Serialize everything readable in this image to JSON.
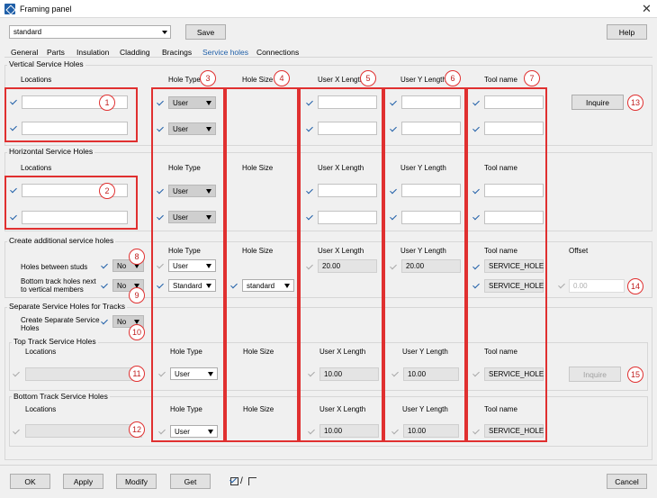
{
  "window": {
    "title": "Framing panel"
  },
  "top": {
    "preset": "standard",
    "save_label": "Save",
    "help_label": "Help"
  },
  "tabs": [
    "General",
    "Parts",
    "Insulation",
    "Cladding",
    "Bracings",
    "Service holes",
    "Connections"
  ],
  "headers": {
    "locations": "Locations",
    "hole_type": "Hole Type",
    "hole_size": "Hole Size",
    "user_x": "User X Length",
    "user_y": "User Y Length",
    "tool_name": "Tool name",
    "offset": "Offset"
  },
  "sections": {
    "vertical": "Vertical Service Holes",
    "horizontal": "Horizontal Service Holes",
    "additional": "Create additional service holes",
    "separate": "Separate Service Holes for Tracks",
    "top_track": "Top Track Service Holes",
    "bottom_track": "Bottom Track Service Holes"
  },
  "values": {
    "user": "User",
    "standard": "Standard",
    "standard_lc": "standard",
    "x_20": "20.00",
    "y_20": "20.00",
    "x_10": "10.00",
    "y_10": "10.00",
    "tool": "SERVICE_HOLE",
    "offset": "0.00",
    "no": "No"
  },
  "additional": {
    "holes_between_studs": "Holes between studs",
    "bottom_track_holes_1": "Bottom track holes next",
    "bottom_track_holes_2": "to vertical members"
  },
  "separate": {
    "label_1": "Create Separate Service",
    "label_2": "Holes"
  },
  "inquire_label": "Inquire",
  "markers": [
    "1",
    "2",
    "3",
    "4",
    "5",
    "6",
    "7",
    "8",
    "9",
    "10",
    "11",
    "12",
    "13",
    "14",
    "15"
  ],
  "footer": {
    "ok": "OK",
    "apply": "Apply",
    "modify": "Modify",
    "get": "Get",
    "toggle": "/",
    "cancel": "Cancel"
  },
  "colors": {
    "accent": "#1f5fa8",
    "annotation": "#e03030"
  }
}
